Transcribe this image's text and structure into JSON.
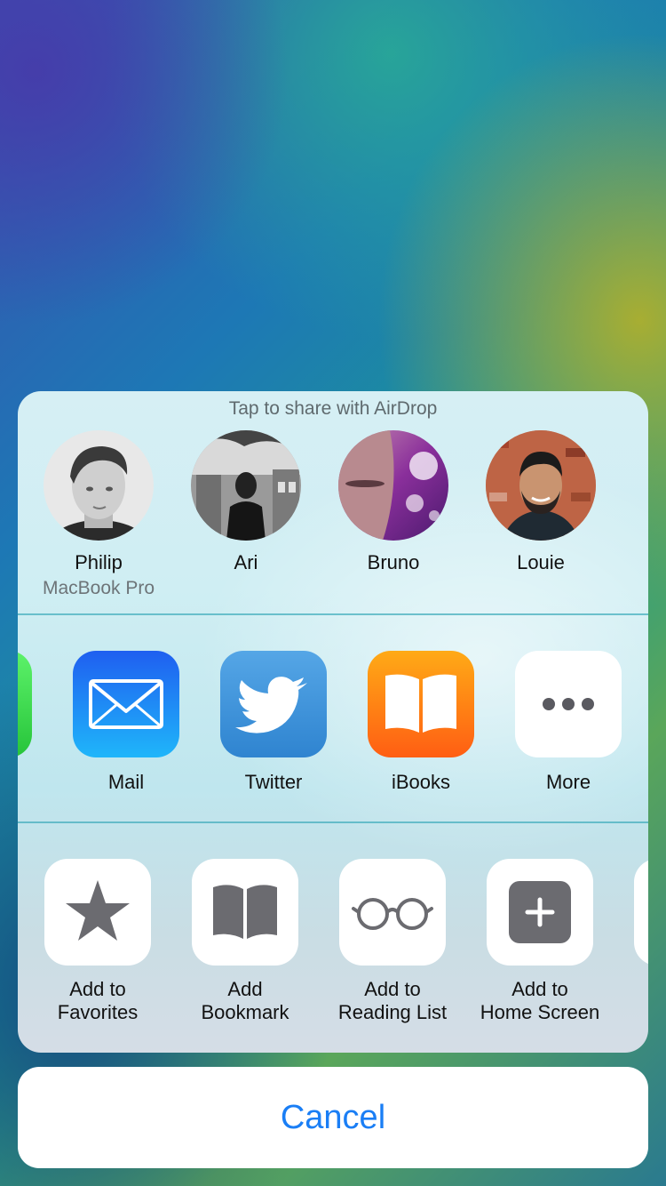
{
  "airdrop": {
    "title": "Tap to share with AirDrop",
    "contacts": [
      {
        "name": "Philip",
        "device": "MacBook Pro"
      },
      {
        "name": "Ari"
      },
      {
        "name": "Bruno"
      },
      {
        "name": "Louie"
      }
    ]
  },
  "share_apps": [
    {
      "label": "Mail",
      "icon": "mail-icon"
    },
    {
      "label": "Twitter",
      "icon": "twitter-icon"
    },
    {
      "label": "iBooks",
      "icon": "ibooks-icon"
    },
    {
      "label": "More",
      "icon": "more-icon"
    }
  ],
  "actions": [
    {
      "line1": "Add to",
      "line2": "Favorites",
      "icon": "star-icon"
    },
    {
      "line1": "Add",
      "line2": "Bookmark",
      "icon": "book-icon"
    },
    {
      "line1": "Add to",
      "line2": "Reading List",
      "icon": "glasses-icon"
    },
    {
      "line1": "Add to",
      "line2": "Home Screen",
      "icon": "plus-square-icon"
    }
  ],
  "cancel_label": "Cancel",
  "colors": {
    "accent": "#1a7ef5",
    "divider": "#46afbe",
    "action_glyph": "#6b6b70"
  }
}
